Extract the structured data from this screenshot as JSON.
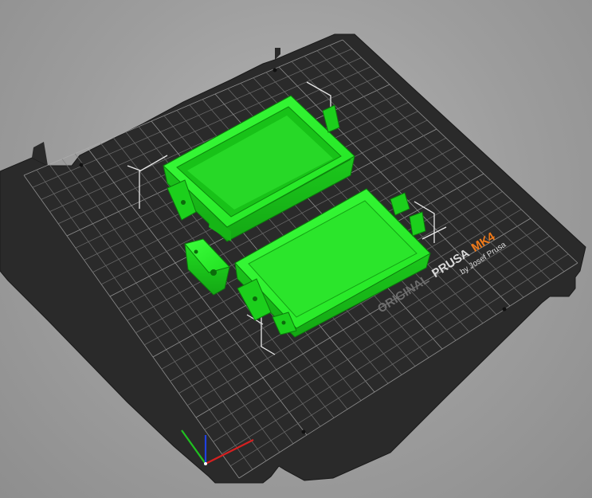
{
  "viewport": {
    "label": "3D plater view"
  },
  "bed": {
    "brand_line1_part1": "ORIGINAL",
    "brand_line1_part2": "PRUSA",
    "brand_line1_part3": "MK4",
    "brand_line2": "by Josef Prusa",
    "sheet_color": "#2b2b2b",
    "grid_color": "#8a8a8a",
    "accent_color": "#f07a1a"
  },
  "objects": [
    {
      "name": "box-body",
      "color": "#1ff01f"
    },
    {
      "name": "box-lid",
      "color": "#1ff01f"
    },
    {
      "name": "hinge-clip",
      "color": "#1ff01f"
    }
  ],
  "axes": {
    "x_color": "#d42020",
    "y_color": "#20c020",
    "z_color": "#2040e0"
  }
}
